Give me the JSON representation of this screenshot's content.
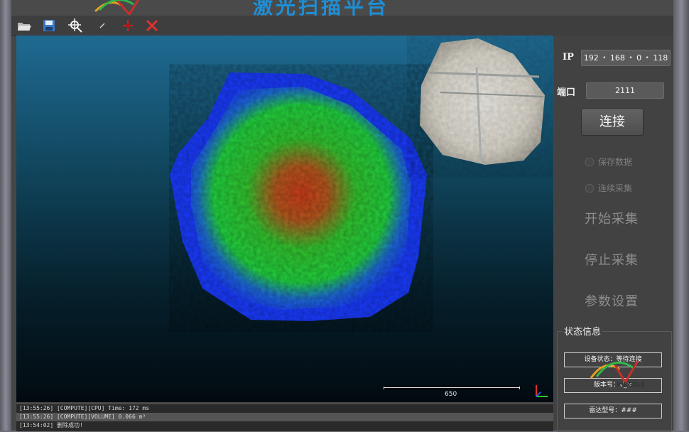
{
  "window": {
    "title": "激光扫描平台"
  },
  "toolbar": {
    "tools": [
      {
        "icon": "open-folder-icon",
        "color": "#dcdcdc"
      },
      {
        "icon": "save-disk-icon",
        "color": "#8fb4e8"
      },
      {
        "icon": "pick-point-icon",
        "color": "#f2f2f2"
      },
      {
        "icon": "small-marker-icon",
        "color": "#d0d0d0"
      },
      {
        "icon": "crosshair-icon",
        "color": "#d02020"
      },
      {
        "icon": "delete-x-icon",
        "color": "#e03030"
      }
    ]
  },
  "viewer": {
    "scale_label": "650",
    "colors": {
      "low": "#1a3cff",
      "mid": "#27d63c",
      "high": "#d23d1c"
    }
  },
  "log": {
    "lines": [
      "[13:55:26] [COMPUTE][CPU] Time: 172 ms",
      "[13:55:26] [COMPUTE][VOLUME] 0.066 m³",
      "[13:54:02] 删除成功!"
    ]
  },
  "connection": {
    "ip_label": "IP",
    "ip": [
      "192",
      "168",
      "0",
      "118"
    ],
    "port_label": "端口",
    "port": "2111",
    "connect_label": "连接"
  },
  "options": {
    "save_data": "保存数据",
    "continuous": "连续采集"
  },
  "actions": {
    "start": "开始采集",
    "stop": "停止采集",
    "params": "参数设置"
  },
  "status": {
    "title": "状态信息",
    "device": "设备状态：等待连接",
    "version": "版本号：V_×",
    "radar": "雷达型号：###"
  }
}
